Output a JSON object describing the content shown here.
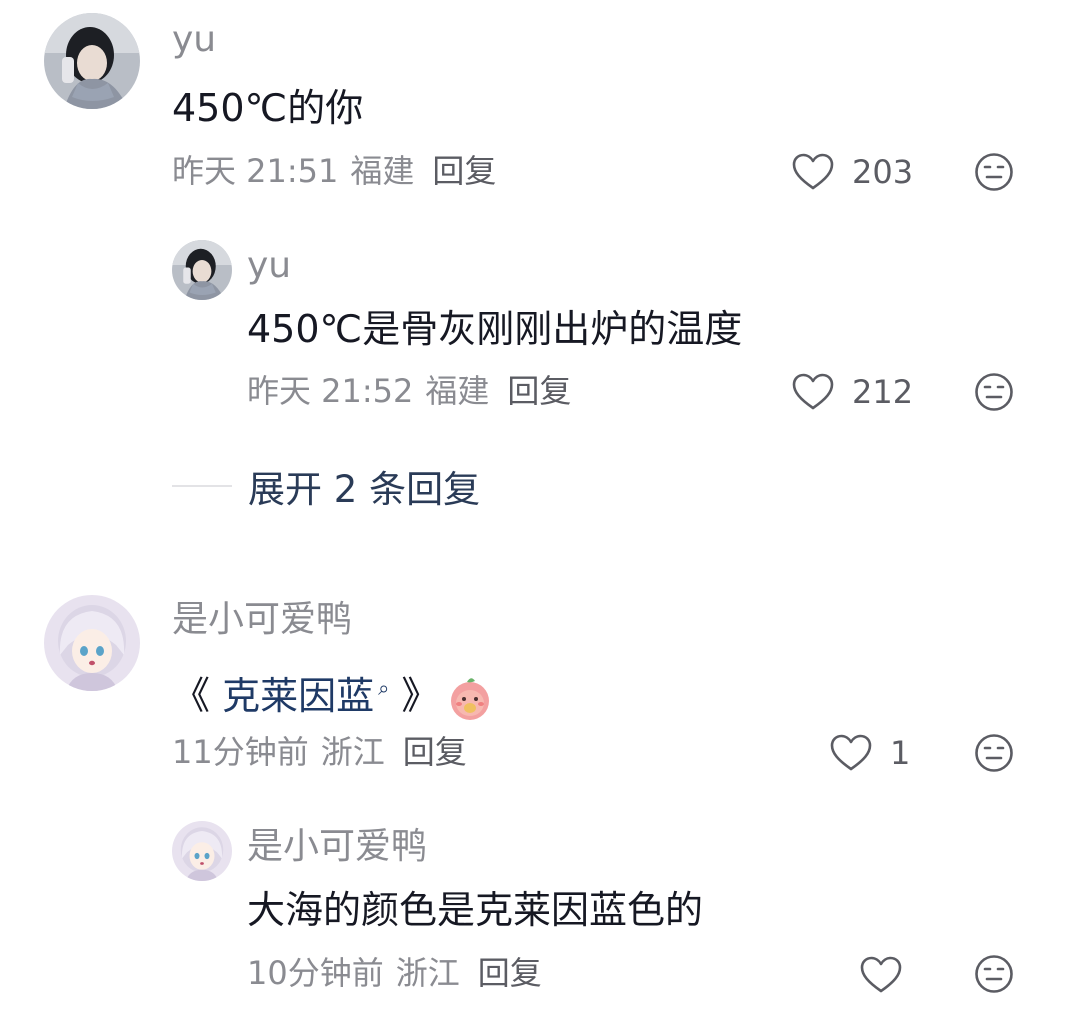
{
  "comments": [
    {
      "username": "yu",
      "text": "450℃的你",
      "time": "昨天 21:51",
      "location": "福建",
      "reply_label": "回复",
      "likes": "203",
      "replies": [
        {
          "username": "yu",
          "text": "450℃是骨灰刚刚出炉的温度",
          "time": "昨天 21:52",
          "location": "福建",
          "reply_label": "回复",
          "likes": "212"
        }
      ],
      "expand_label": "展开 2 条回复"
    },
    {
      "username": "是小可爱鸭",
      "text_open": "《",
      "text_link": "克莱因蓝",
      "text_close": "》",
      "time": "11分钟前",
      "location": "浙江",
      "reply_label": "回复",
      "likes": "1",
      "replies": [
        {
          "username": "是小可爱鸭",
          "text": "大海的颜色是克莱因蓝色的",
          "time": "10分钟前",
          "location": "浙江",
          "reply_label": "回复",
          "likes": ""
        }
      ]
    }
  ],
  "icons": {
    "like": "heart-outline-icon",
    "dislike": "meh-face-icon",
    "search": "search-icon",
    "emoji": "peach-emoji-icon"
  },
  "colors": {
    "text_primary": "#161823",
    "text_secondary": "#8a8b91",
    "link": "#1f3a66"
  }
}
